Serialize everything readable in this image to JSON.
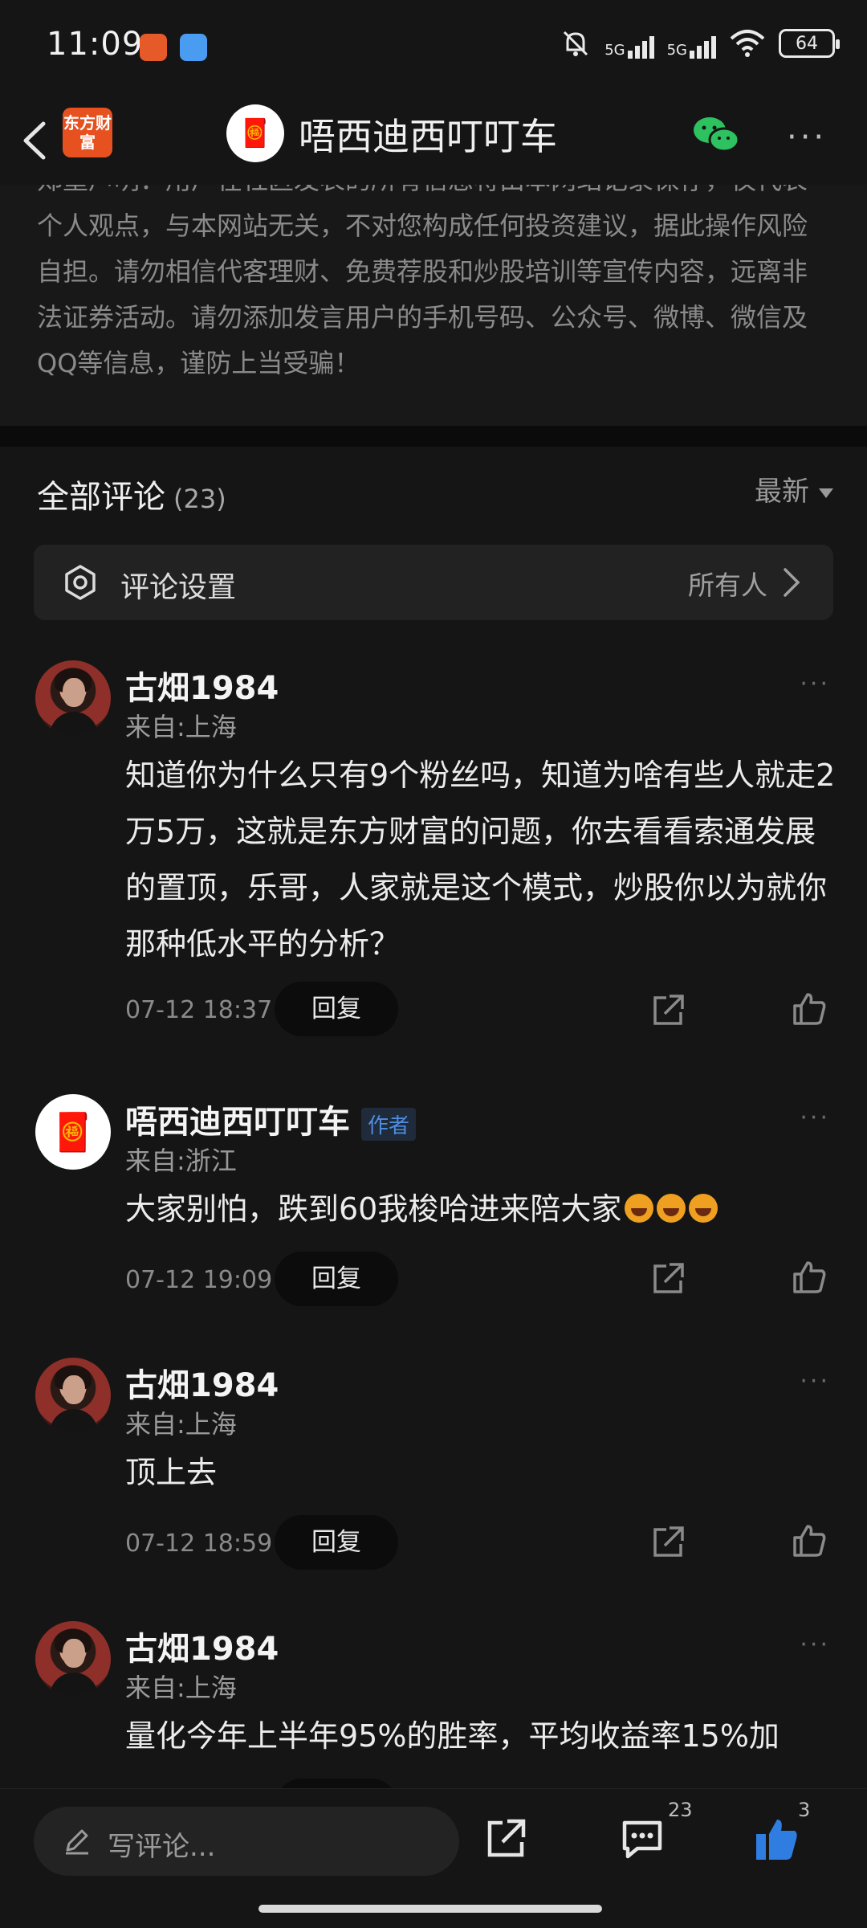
{
  "status_bar": {
    "time": "11:09",
    "signal1": "5G",
    "signal2": "5G",
    "battery": "64"
  },
  "header": {
    "logo_text": "东方财富",
    "title": "唔西迪西叮叮车"
  },
  "disclaimer": "郑重声明：用户在社区发表的所有信息将由本网站记录保存，仅代表个人观点，与本网站无关，不对您构成任何投资建议，据此操作风险自担。请勿相信代客理财、免费荐股和炒股培训等宣传内容，远离非法证券活动。请勿添加发言用户的手机号码、公众号、微博、微信及QQ等信息，谨防上当受骗！",
  "comments_section": {
    "title": "全部评论",
    "count": "(23)",
    "sort": "最新",
    "settings_label": "评论设置",
    "settings_value": "所有人"
  },
  "comments": [
    {
      "name": "古畑1984",
      "from": "来自:上海",
      "text": "知道你为什么只有9个粉丝吗，知道为啥有些人就走2万5万，这就是东方财富的问题，你去看看索通发展的置顶，乐哥，人家就是这个模式，炒股你以为就你那种低水平的分析？",
      "date": "07-12 18:37",
      "reply": "回复"
    },
    {
      "name": "唔西迪西叮叮车",
      "badge": "作者",
      "from": "来自:浙江",
      "text": "大家别怕，跌到60我梭哈进来陪大家",
      "date": "07-12 19:09",
      "reply": "回复"
    },
    {
      "name": "古畑1984",
      "from": "来自:上海",
      "text": "顶上去",
      "date": "07-12 18:59",
      "reply": "回复"
    },
    {
      "name": "古畑1984",
      "from": "来自:上海",
      "text": "量化今年上半年95%的胜率，平均收益率15%加",
      "date": "",
      "reply": "回复"
    }
  ],
  "bottom_bar": {
    "placeholder": "写评论...",
    "comment_count": "23",
    "like_count": "3"
  }
}
